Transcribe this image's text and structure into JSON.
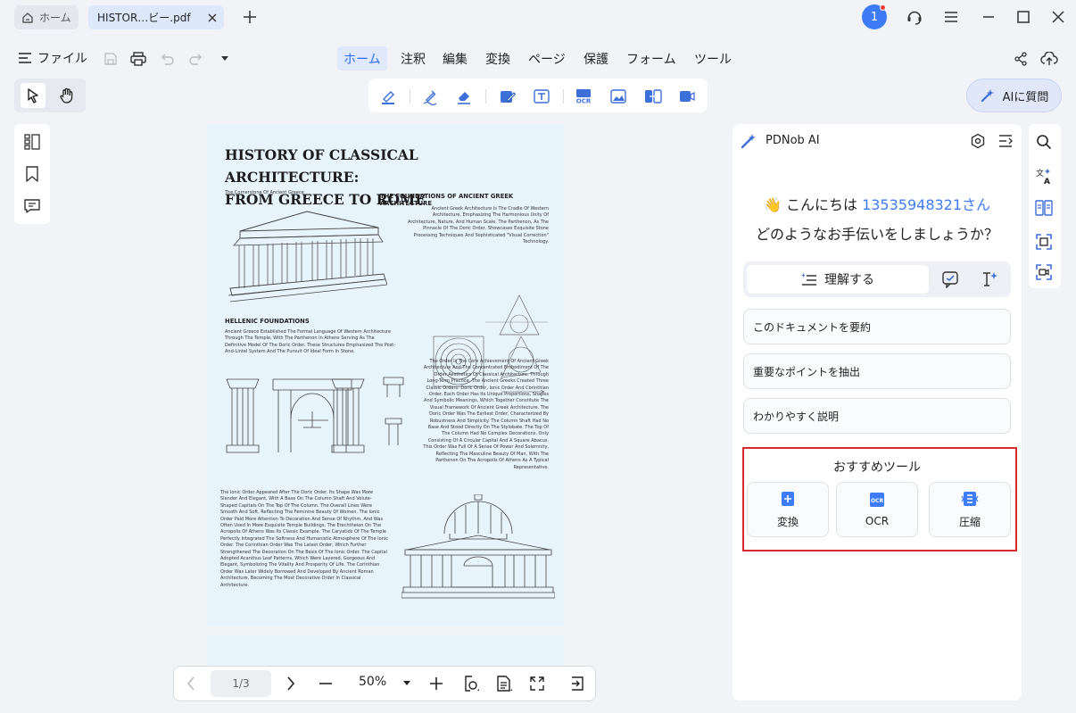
{
  "tabs": {
    "home_label": "ホーム",
    "file_label": "HISTOR…ビー.pdf"
  },
  "account": {
    "badge": "1"
  },
  "menu": {
    "file_label": "ファイル",
    "items": [
      "ホーム",
      "注釈",
      "編集",
      "変換",
      "ページ",
      "保護",
      "フォーム",
      "ツール"
    ],
    "active_index": 0
  },
  "ai_button": {
    "label": "AIに質問"
  },
  "document": {
    "title_line1": "HISTORY OF CLASSICAL  ARCHITECTURE:",
    "title_line2": "FROM GREECE TO ROME",
    "subtitle": "The Cornerstone Of Ancient Greece",
    "section1_heading": "THE FOUNDATIONS OF ANCIENT GREEK ARCHITECTURE",
    "section1_text": "Ancient Greek Architecture Is The Cradle Of Western Architecture, Emphasizing The Harmonious Unity Of Architecture, Nature, And Human Scale. The Parthenon, As The Pinnacle Of The Doric Order, Showcases Exquisite Stone Processing Techniques And Sophisticated \"Visual Correction\" Technology.",
    "section2_heading": "HELLENIC FOUNDATIONS",
    "section2_text": "Ancient Greece Established The Formal Language Of Western Architecture Through The Temple, With The Parthenon In Athens Serving As The Definitive Model Of The Doric Order. These Structures Emphasized The Post-And-Lintel System And The Pursuit Of Ideal Form In Stone.",
    "section3_text": "The Order Is The Core Achievement Of Ancient Greek Architecture And The Concentrated Embodiment Of The Order Aesthetics Of Classical Architecture. Through Long-Term Practice, The Ancient Greeks Created Three Classic Orders: Doric Order, Ionic Order And Corinthian Order. Each Order Has Its Unique Proportions, Shapes And Symbolic Meanings, Which Together Constitute The Visual Framework Of Ancient Greek Architecture. The Doric Order Was The Earliest Order, Characterized By Robustness And Simplicity. The Column Shaft Had No Base And Stood Directly On The Stylobate. The Top Of The Column Had No Complex Decorations, Only Consisting Of A Circular Capital And A Square Abacus. This Order Was Full Of A Sense Of Power And Solemnity, Reflecting The Masculine Beauty Of Man, With The Parthenon On The Acropolis Of Athens As A Typical Representative.",
    "section4_text": "The Ionic Order Appeared After The Doric Order. Its Shape Was More Slender And Elegant, With A Base On The Column Shaft And Volute-Shaped Capitals On The Top Of The Column. The Overall Lines Were Smooth And Soft, Reflecting The Feminine Beauty Of Women. The Ionic Order Paid More Attention To Decoration And Sense Of Rhythm, And Was Often Used In More Exquisite Temple Buildings. The Erechtheion On The Acropolis Of Athens Was Its Classic Example. The Caryatids Of The Temple Perfectly Integrated The Softness And Humanistic Atmosphere Of The Ionic Order. The Corinthian Order Was The Latest Order, Which Further Strengthened The Decoration On The Basis Of The Ionic Order. The Capital Adopted Acanthus Leaf Patterns, Which Were Layered, Gorgeous And Elegant, Symbolizing The Vitality And Prosperity Of Life. The Corinthian Order Was Later Widely Borrowed And Developed By Ancient Roman Architecture, Becoming The Most Decorative Order In Classical Architecture."
  },
  "navigation": {
    "page_indicator": "1/3",
    "zoom": "50%"
  },
  "ai_panel": {
    "title": "PDNob AI",
    "greeting_prefix": "こんにちは",
    "user_id": "13535948321",
    "greeting_suffix": "さん",
    "question": "どのようなお手伝いをしましょうか？",
    "mode_label": "理解する",
    "prompts": [
      "このドキュメントを要約",
      "重要なポイントを抽出",
      "わかりやすく説明"
    ],
    "recommended_title": "おすすめツール",
    "tools": [
      "変換",
      "OCR",
      "圧縮"
    ]
  },
  "colors": {
    "accent": "#3d7cf6",
    "highlight_border": "#d72b2b",
    "page_background": "#e8f4fc"
  }
}
